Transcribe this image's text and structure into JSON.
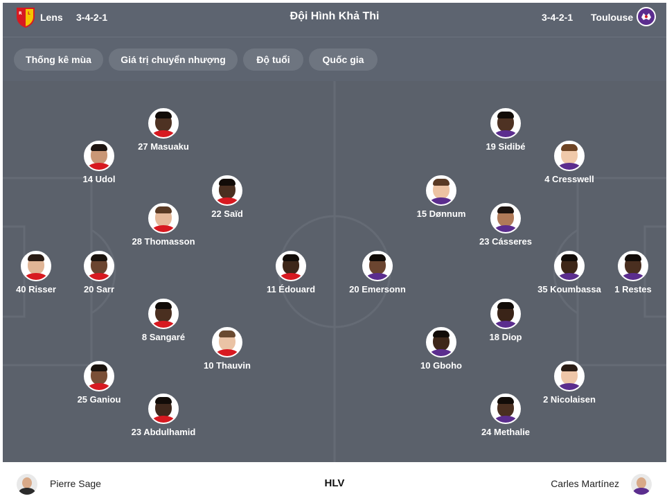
{
  "header": {
    "title": "Đội Hình Khả Thi",
    "home": {
      "name": "Lens",
      "formation": "3-4-2-1"
    },
    "away": {
      "name": "Toulouse",
      "formation": "3-4-2-1"
    }
  },
  "toolbar": {
    "chips": [
      "Thống kê mùa",
      "Giá trị chuyển nhượng",
      "Độ tuổi",
      "Quốc gia"
    ]
  },
  "home_players": [
    {
      "label": "40 Risser"
    },
    {
      "label": "14 Udol"
    },
    {
      "label": "20 Sarr"
    },
    {
      "label": "25 Ganiou"
    },
    {
      "label": "27 Masuaku"
    },
    {
      "label": "28 Thomasson"
    },
    {
      "label": "8 Sangaré"
    },
    {
      "label": "23 Abdulhamid"
    },
    {
      "label": "22 Saïd"
    },
    {
      "label": "10 Thauvin"
    },
    {
      "label": "11 Édouard"
    }
  ],
  "away_players": [
    {
      "label": "1 Restes"
    },
    {
      "label": "4 Cresswell"
    },
    {
      "label": "35 Koumbassa"
    },
    {
      "label": "2 Nicolaisen"
    },
    {
      "label": "19 Sidibé"
    },
    {
      "label": "23 Cásseres"
    },
    {
      "label": "18 Diop"
    },
    {
      "label": "24 Methalie"
    },
    {
      "label": "15 Dønnum"
    },
    {
      "label": "10 Gboho"
    },
    {
      "label": "20 Emersonn"
    }
  ],
  "footer": {
    "home_coach": "Pierre Sage",
    "coach_label": "HLV",
    "away_coach": "Carles Martínez"
  },
  "colors": {
    "bar_bg": "#5d6470",
    "pitch_bg": "#5b616b",
    "chip_bg": "#6e7580",
    "lens_red": "#d71920",
    "lens_yellow": "#f5c400",
    "toulouse_purple": "#5b2d8e"
  }
}
